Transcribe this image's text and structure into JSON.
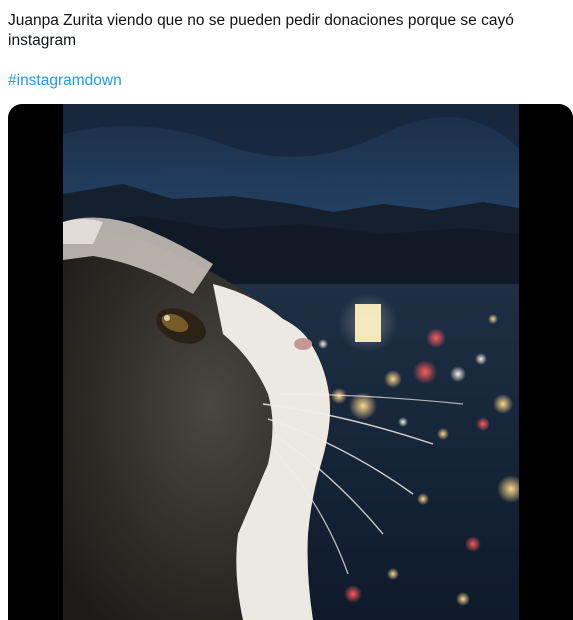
{
  "tweet": {
    "text_line1": "Juanpa Zurita viendo que no se pueden pedir donaciones porque se cayó",
    "text_line2": "instagram",
    "hashtag": "#instagramdown"
  },
  "media": {
    "kind": "video",
    "subject": "cat-looking-at-city-lights"
  }
}
